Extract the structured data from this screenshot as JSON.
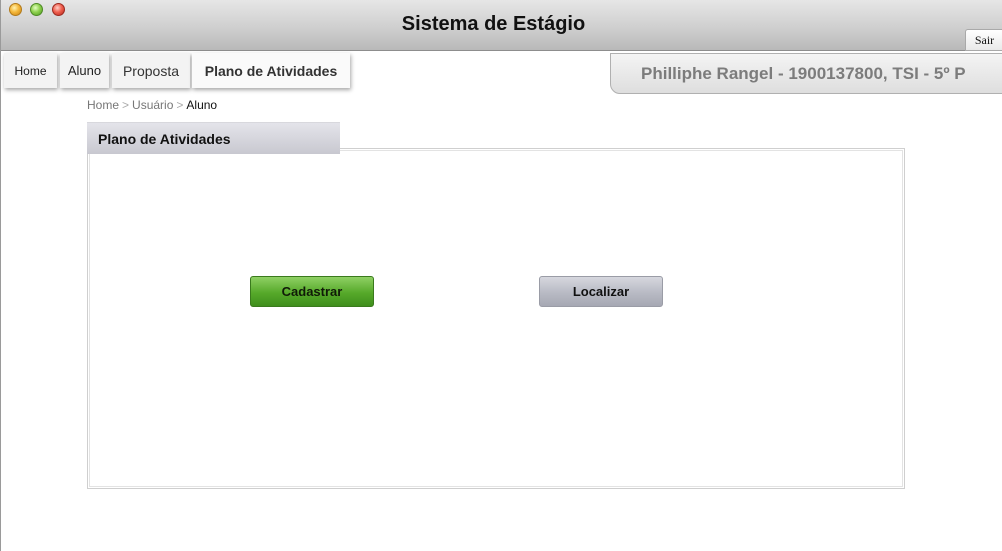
{
  "app": {
    "title": "Sistema de Estágio",
    "logout_label": "Sair"
  },
  "nav": {
    "tabs": [
      {
        "label": "Home"
      },
      {
        "label": "Aluno"
      },
      {
        "label": "Proposta"
      },
      {
        "label": "Plano de Atividades",
        "active": true
      }
    ]
  },
  "user": {
    "info": "Philliphe Rangel - 1900137800, TSI - 5º P"
  },
  "breadcrumb": {
    "items": [
      "Home",
      "Usuário",
      "Aluno"
    ],
    "separator": ">"
  },
  "panel": {
    "title": "Plano de Atividades",
    "buttons": {
      "register_label": "Cadastrar",
      "search_label": "Localizar"
    }
  },
  "colors": {
    "register_button": "#56a92a",
    "search_button": "#b8bac4",
    "panel_tab": "#d4d4dc",
    "user_info_text": "#7c7c7c"
  }
}
